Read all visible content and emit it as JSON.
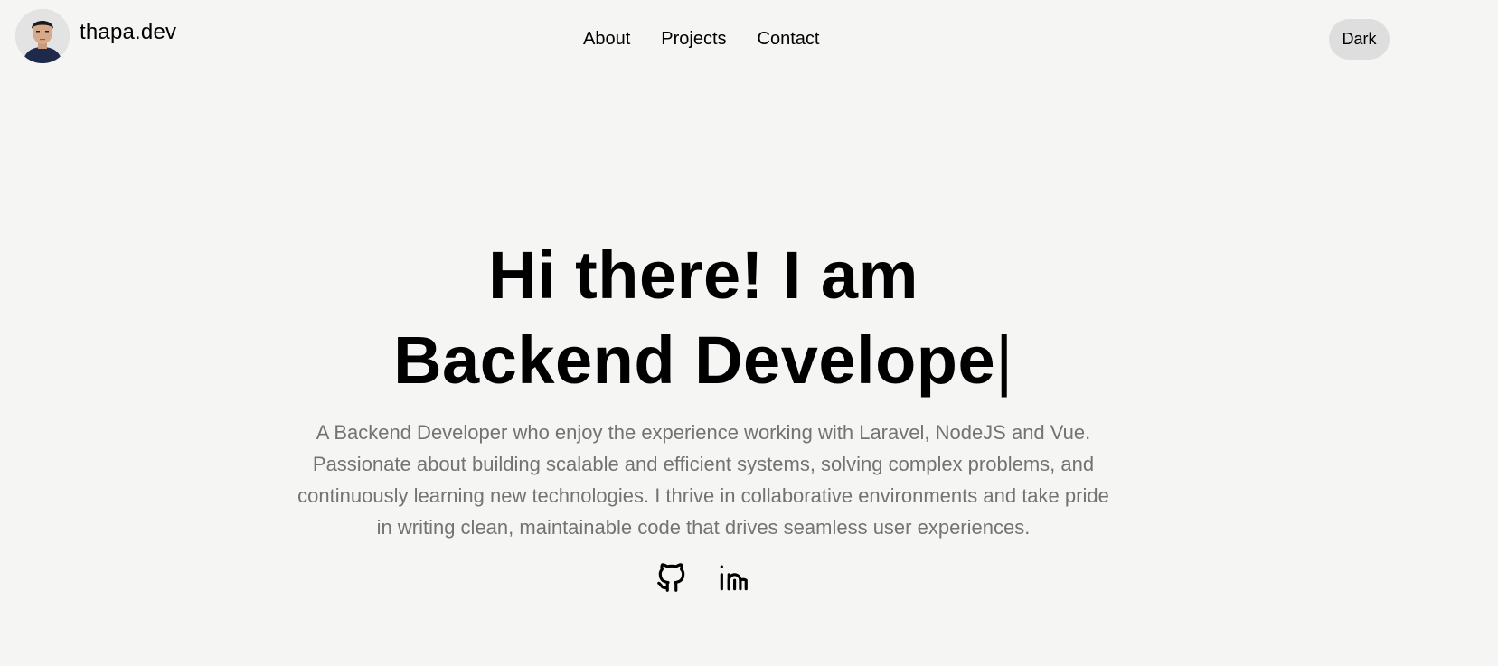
{
  "header": {
    "brand": "thapa.dev",
    "nav": [
      {
        "label": "About"
      },
      {
        "label": "Projects"
      },
      {
        "label": "Contact"
      }
    ],
    "theme_toggle_label": "Dark"
  },
  "hero": {
    "title_line1": "Hi there! I am",
    "title_line2": "Backend Develope",
    "caret": "|",
    "description": "A Backend Developer who enjoy the experience working with Laravel, NodeJS and Vue. Passionate about building scalable and efficient systems, solving complex problems, and continuously learning new technologies. I thrive in collaborative environments and take pride in writing clean, maintainable code that drives seamless user experiences."
  },
  "socials": [
    {
      "icon": "github-icon"
    },
    {
      "icon": "linkedin-icon"
    }
  ],
  "colors": {
    "background": "#f5f5f4",
    "toggle_bg": "#dedede",
    "muted_text": "#737373"
  }
}
